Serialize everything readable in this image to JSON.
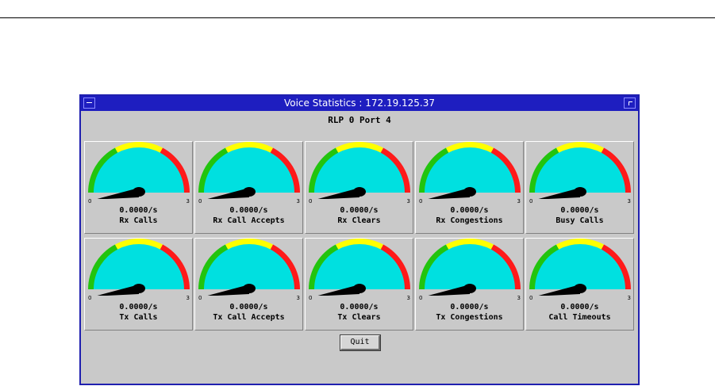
{
  "window": {
    "title": "Voice Statistics : 172.19.125.37",
    "subtitle": "RLP 0 Port 4"
  },
  "gauges": [
    {
      "rate": "0.0000/s",
      "label": "Rx Calls",
      "min": "0",
      "max": "3",
      "value": 0
    },
    {
      "rate": "0.0000/s",
      "label": "Rx Call Accepts",
      "min": "0",
      "max": "3",
      "value": 0
    },
    {
      "rate": "0.0000/s",
      "label": "Rx Clears",
      "min": "0",
      "max": "3",
      "value": 0
    },
    {
      "rate": "0.0000/s",
      "label": "Rx Congestions",
      "min": "0",
      "max": "3",
      "value": 0
    },
    {
      "rate": "0.0000/s",
      "label": "Busy Calls",
      "min": "0",
      "max": "3",
      "value": 0
    },
    {
      "rate": "0.0000/s",
      "label": "Tx Calls",
      "min": "0",
      "max": "3",
      "value": 0
    },
    {
      "rate": "0.0000/s",
      "label": "Tx Call Accepts",
      "min": "0",
      "max": "3",
      "value": 0
    },
    {
      "rate": "0.0000/s",
      "label": "Tx Clears",
      "min": "0",
      "max": "3",
      "value": 0
    },
    {
      "rate": "0.0000/s",
      "label": "Tx Congestions",
      "min": "0",
      "max": "3",
      "value": 0
    },
    {
      "rate": "0.0000/s",
      "label": "Call Timeouts",
      "min": "0",
      "max": "3",
      "value": 0
    }
  ],
  "buttons": {
    "quit": "Quit"
  },
  "colors": {
    "dial_face": "#00e0e0",
    "zone_low": "#22c40e",
    "zone_mid": "#ffff00",
    "zone_high": "#ff1a1a",
    "needle": "#000000",
    "titlebar": "#1e1ec0"
  }
}
